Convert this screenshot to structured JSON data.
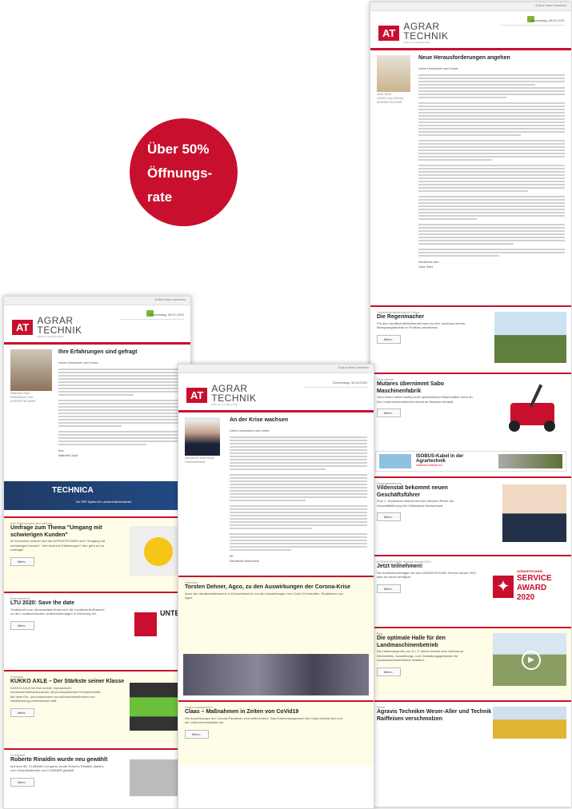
{
  "badge": {
    "line1": "Über 50%",
    "line2": "Öffnungs-",
    "line3": "rate"
  },
  "brand": {
    "logo_box": "AT",
    "logo_line1": "AGRAR",
    "logo_line2": "TECHNIK",
    "tagline": "ERFOLG & ANSICHTEN",
    "red": "#c8102e",
    "green": "#7ab83a"
  },
  "newsletters": [
    {
      "browser_link": "Online lesen ansehen",
      "date": "Donnerstag, 06.01.2022",
      "editorial": {
        "title": "Ihre Erfahrungen sind gefragt",
        "greeting": "Liebe Leserinnen und Leser,",
        "author_name": "Nathalie Zapf",
        "author_role": "Redakteurin der AGRARTECHNIK",
        "sign_off": "Ihre",
        "signature": "Nathalie Zapf"
      },
      "ad": {
        "text": "TECHNICA",
        "subtext": "Der ERP System für Landtechnikhandwerker"
      },
      "items": [
        {
          "kicker": "Ihre Erfahrungen sind gefragt",
          "title": "Umfrage zum Thema \"Umgang mit schwierigen Kunden\"",
          "text": "Im Dezember widmet sich die AGRARTECHNIK dem \"Umgang mit schwierigen Kunden\". Wie sind Ihre Erfahrungen? Hier geht es zur Umfrage!",
          "button": "Mehr..."
        },
        {
          "kicker": "Branchentreff",
          "title": "LTU 2020: Save the date",
          "text": "Traditionell zum Jahresauftakt findet sich die Landtechnik-Branche zu den Landtechnischen Unternehmertagen in Würzburg ein.",
          "button": "Mehr...",
          "logo": "UNTERNEHMERTAGE"
        },
        {
          "kicker": "Produkte",
          "title": "KUKKO AXLE – Der Stärkste seiner Klasse",
          "text": "KUKKO AXLE ist eine mobile, hydraulische Achsschenkelbolzenpresse mit pneumatischem Pumpenantrieb, die beim Ein- und Auspressen von Achsschenkelbolzen von Nutzfahrzeug-Vorderachsen hilft.",
          "button": "Mehr..."
        },
        {
          "kicker": "CLIMMAR",
          "title": "Roberto Rinaldin wurde neu gewählt",
          "text": "Auf dem 56. CLIMMAR-Kongress wurde Roberto Rinaldin (Italien) zum Vizepräsidenten von CLIMMAR gewählt.",
          "button": "Mehr..."
        }
      ]
    },
    {
      "browser_link": "Online lesen ansehen",
      "date": "Donnerstag, 30.04.2020",
      "editorial": {
        "title": "An der Krise wachsen",
        "greeting": "Liebe Leserinnen und Leser,",
        "author_name": "Alexander Bohnsack",
        "author_role": "Chefredakteur",
        "sign_off": "Ihr",
        "signature": "Alexander Bohnsack"
      },
      "items": [
        {
          "kicker": "Interview",
          "title": "Torsten Dehner, Agco, zu den Auswirkungen der Corona-Krise",
          "text": "Auch die Landtechnikbranche in Deutschland ist von den Auswirkungen von Covid-19 betroffen. Reaktionen von Agco.",
          "button": "Mehr..."
        },
        {
          "kicker": "Krisenmanagement",
          "title": "Claas – Maßnahmen in Zeiten von CoVid19",
          "text": "Die Auswirkungen der Corona-Pandemie sind weitreichend. Das Krisenmanagement bei Claas erweist sich von der Unternehmensseite her.",
          "button": "Mehr..."
        }
      ]
    },
    {
      "browser_link": "Online lesen ansehen",
      "date": "Donnerstag, 08.01.2021",
      "editorial": {
        "title": "Neue Herausforderungen angehen",
        "greeting": "Liebe Leserinnen und Leser,",
        "author_name": "Julia Seitz",
        "author_role": "Chefin vom Dienst, AGRARTECHNIK",
        "sign_off": "Herzlichst Ihre",
        "signature": "Julia Seitz"
      },
      "ad": {
        "text": "ISOBUS-Kabel in der Agrartechnik",
        "subtext": "mitsubishi-electric.eu"
      },
      "items": [
        {
          "kicker": "Gartenbewässerung im Fokus",
          "title": "Die Regenmacher",
          "text": "Für den Landtechnikfachhandel kann es sich durchaus lohnen, Beregnungstechnik im Portfolio anzubieten.",
          "button": "Mehr..."
        },
        {
          "kicker": "Übernahme",
          "title": "Mutares übernimmt Sabo Maschinenfabrik",
          "text": "John Deere bietet künftig keine gewerblichen Rasenmäher mehr an. Der Unternehmensbereich wurde an Mutares verkauft.",
          "button": "Mehr..."
        },
        {
          "kicker": "Personalmeldung",
          "title": "Vildenstat bekommt neuen Geschäftsführer",
          "text": "Zum 1. September übernimmt Karl-Heinrich Reher die Geschäftsführung bei Vildenstadt Deutschland.",
          "button": "Mehr..."
        },
        {
          "kicker": "AGRARTECHNIK Service Award 2021",
          "title": "Jetzt teilnehmen!",
          "text": "Die Anmeldeunterlagen für den AGRARTECHNIK Service Award 2021 sind ab sofort verfügbar.",
          "button": "Mehr...",
          "award": {
            "line1": "AGRARTECHNIK",
            "line2": "SERVICE",
            "line3": "AWARD",
            "line4": "2020"
          }
        },
        {
          "kicker": "Bau",
          "title": "Die optimale Halle für den Landmaschinenbetrieb",
          "text": "Die Hallenbauprofis von E.L.F. haben bereits eine Vielzahl an Werkstätten, Ausstellungs- und Verwaltungsgebäuden für Landmaschinenbetriebe realisiert.",
          "button": "Mehr..."
        },
        {
          "kicker": "News",
          "title": "Agravis Technikm Weser-Aller und Technik Raiffeisen verschmolzen",
          "text": "",
          "button": "Mehr..."
        }
      ]
    }
  ]
}
